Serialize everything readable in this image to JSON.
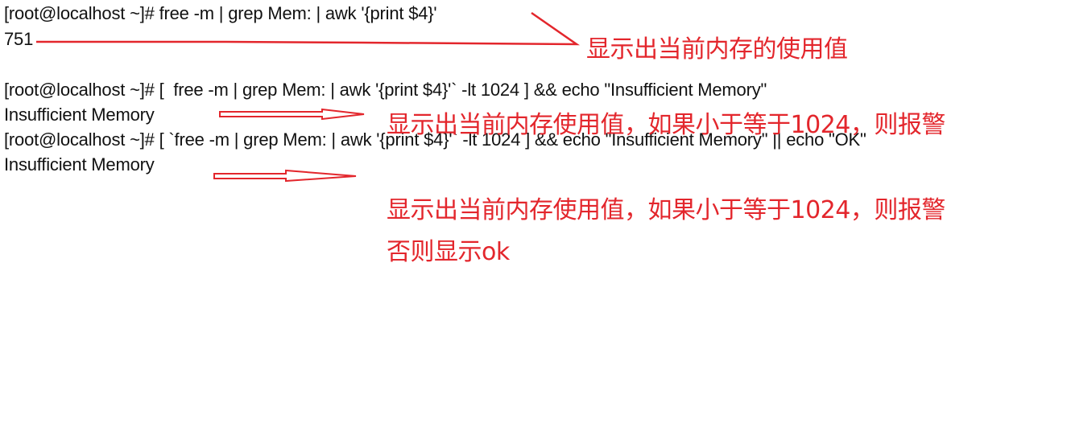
{
  "terminal": {
    "lines": [
      "[root@localhost ~]# free -m | grep Mem: | awk '{print $4}'",
      "751",
      "[root@localhost ~]# [  free -m | grep Mem: | awk '{print $4}'` -lt 1024 ] && echo \"Insufficient Memory\"",
      "Insufficient Memory",
      "[root@localhost ~]# [ `free -m | grep Mem: | awk '{print $4}'` -lt 1024 ] && echo \"Insufficient Memory\" || echo \"OK\"",
      "Insufficient Memory"
    ]
  },
  "annotations": {
    "note1": "显示出当前内存的使用值",
    "note2": "显示出当前内存使用值，如果小于等于1024，则报警",
    "note3_line1": "显示出当前内存使用值，如果小于等于1024，则报警",
    "note3_line2": "否则显示ok",
    "color": "#e3262c"
  }
}
